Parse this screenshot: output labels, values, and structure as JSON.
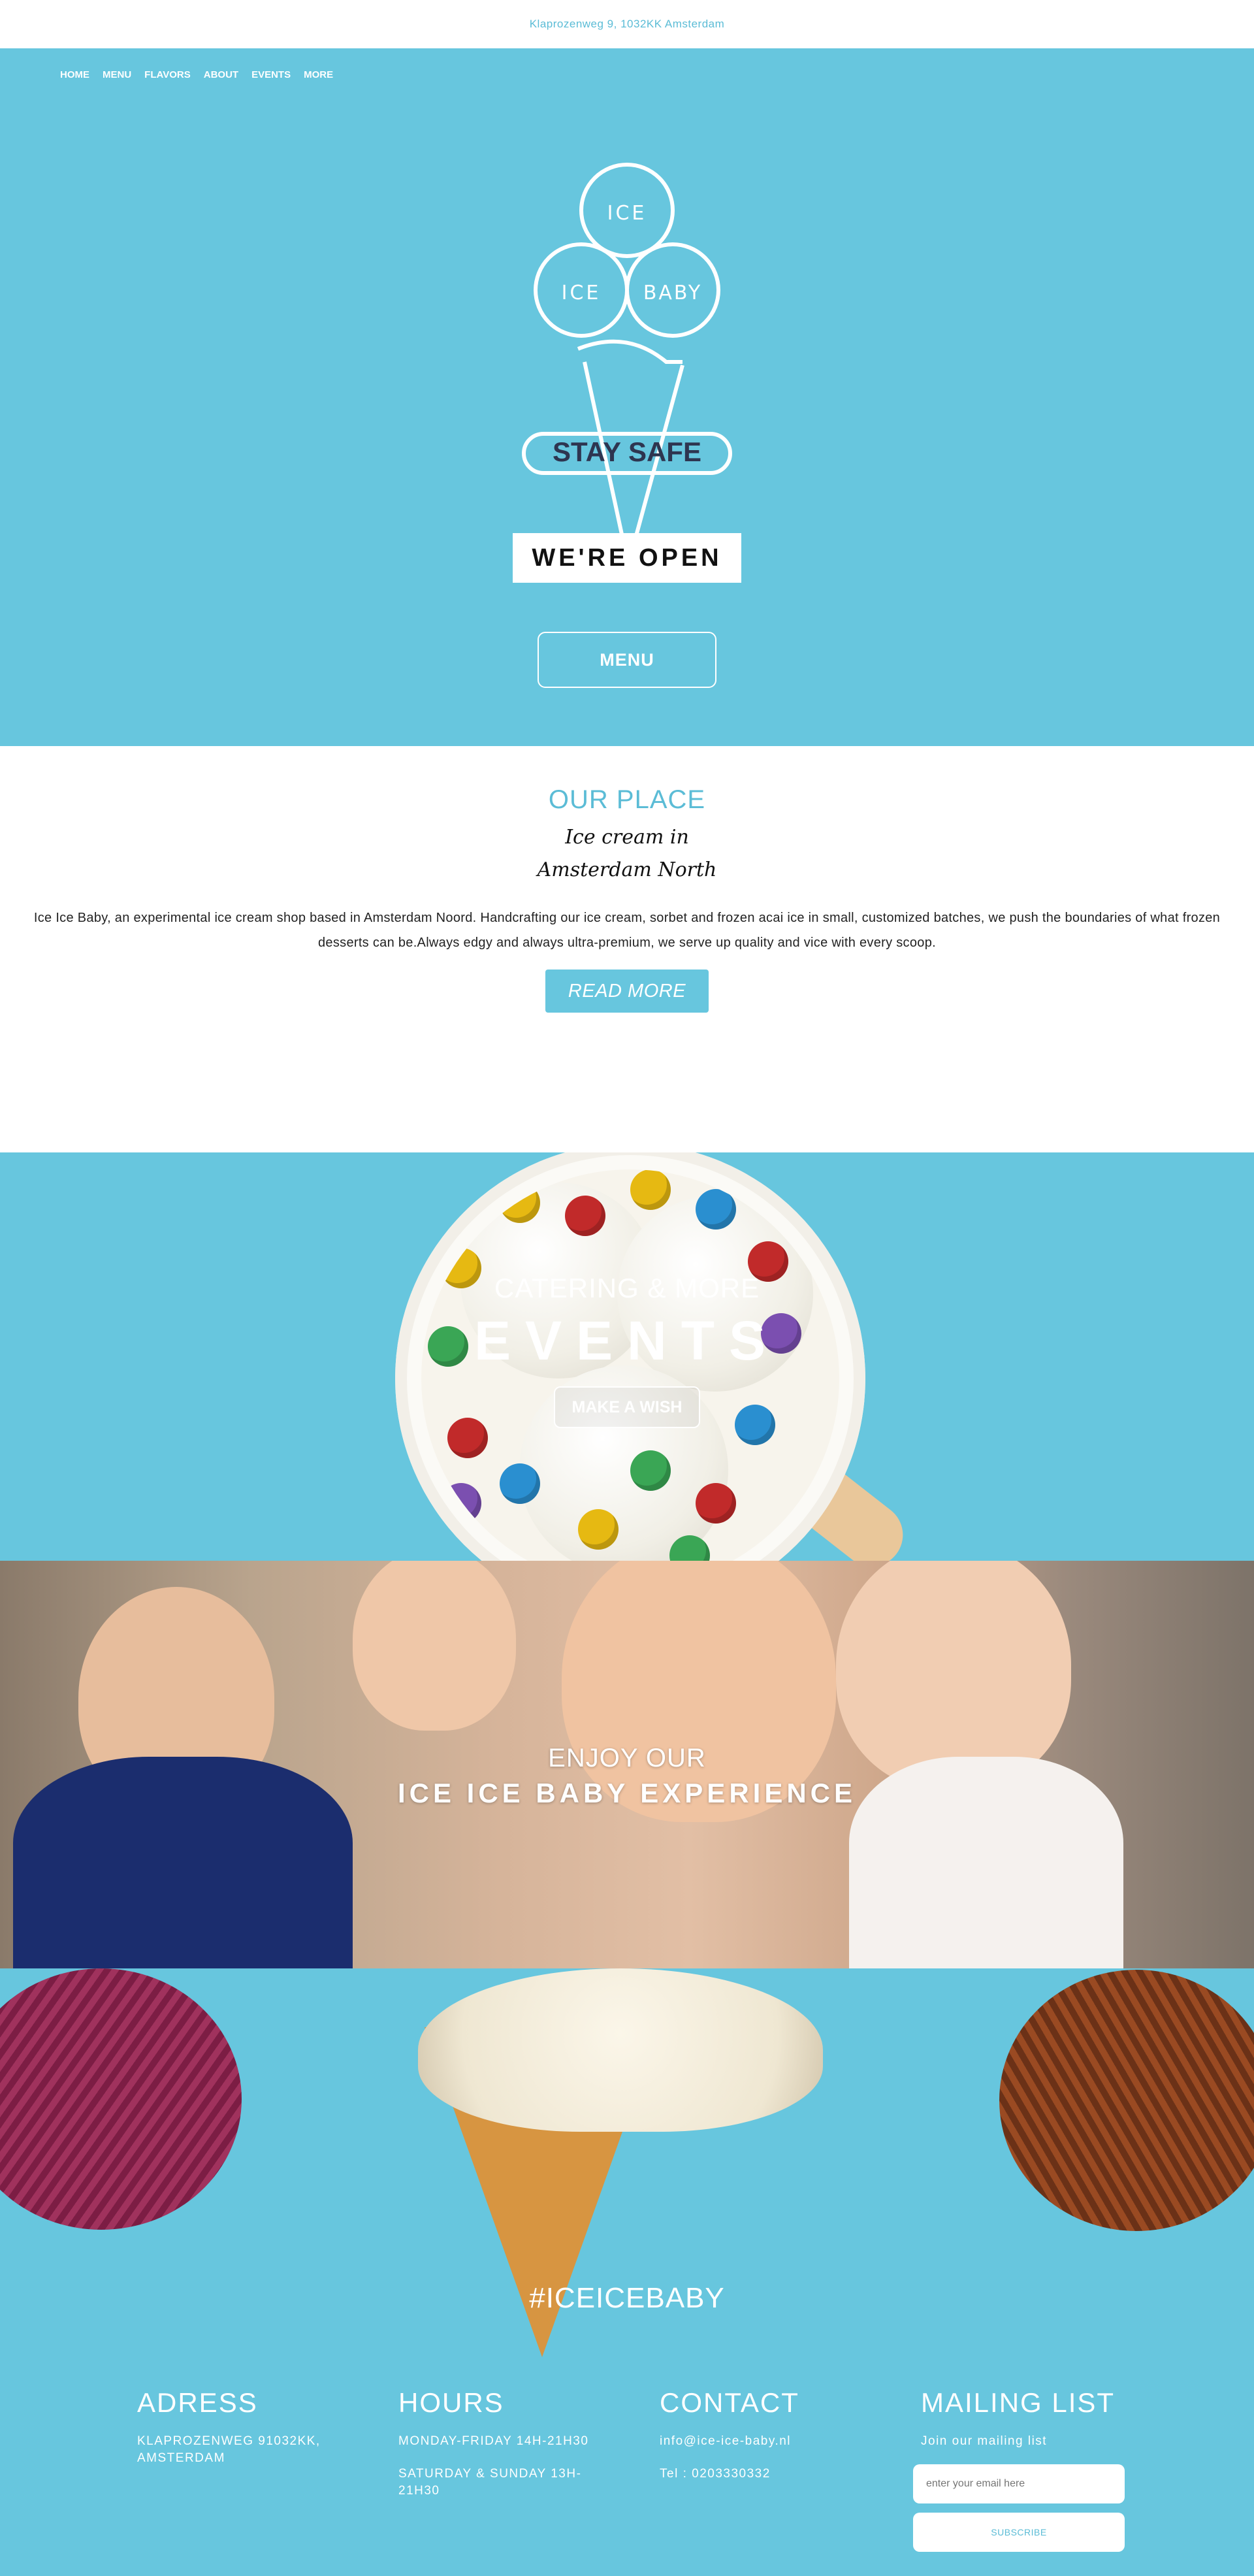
{
  "topbar": {
    "address": "Klaprozenweg 9, 1032KK Amsterdam"
  },
  "nav": {
    "items": [
      "HOME",
      "MENU",
      "FLAVORS",
      "ABOUT",
      "EVENTS",
      "MORE"
    ]
  },
  "hero": {
    "logo_scoops": [
      "ICE",
      "ICE",
      "BABY"
    ],
    "logo_banner": "STAY SAFE",
    "badge": "WE'RE OPEN",
    "menu_button": "MENU"
  },
  "place": {
    "title": "OUR PLACE",
    "script_line1": "Ice cream in",
    "script_line2": "Amsterdam North",
    "description": "Ice Ice Baby, an experimental ice cream shop based in Amsterdam Noord. Handcrafting our ice cream, sorbet and frozen acai ice in small, customized batches, we push the boundaries of what frozen desserts can be.Always edgy and always ultra-premium, we serve up quality and vice with every scoop.",
    "read_more": "READ MORE"
  },
  "events": {
    "subtitle": "CATERING & MORE",
    "title": "EVENTS",
    "button": "MAKE A WISH"
  },
  "experience": {
    "line1": "ENJOY OUR",
    "line2": "ICE ICE BABY EXPERIENCE"
  },
  "hashtag": {
    "text": "#ICEICEBABY"
  },
  "footer": {
    "address": {
      "title": "ADRESS",
      "line": "KLAPROZENWEG 91032KK, AMSTERDAM"
    },
    "hours": {
      "title": "HOURS",
      "line1": "MONDAY-FRIDAY 14H-21H30",
      "line2": "SATURDAY & SUNDAY 13H-21H30"
    },
    "contact": {
      "title": "CONTACT",
      "email": "info@ice-ice-baby.nl",
      "phone": "Tel : 0203330332"
    },
    "mailing": {
      "title": "MAILING LIST",
      "subtitle": "Join our mailing list",
      "placeholder": "enter your email here",
      "button": "SUBSCRIBE"
    }
  },
  "colors": {
    "brand_blue": "#67c6de",
    "text_blue": "#5bbcd6",
    "white": "#ffffff"
  }
}
